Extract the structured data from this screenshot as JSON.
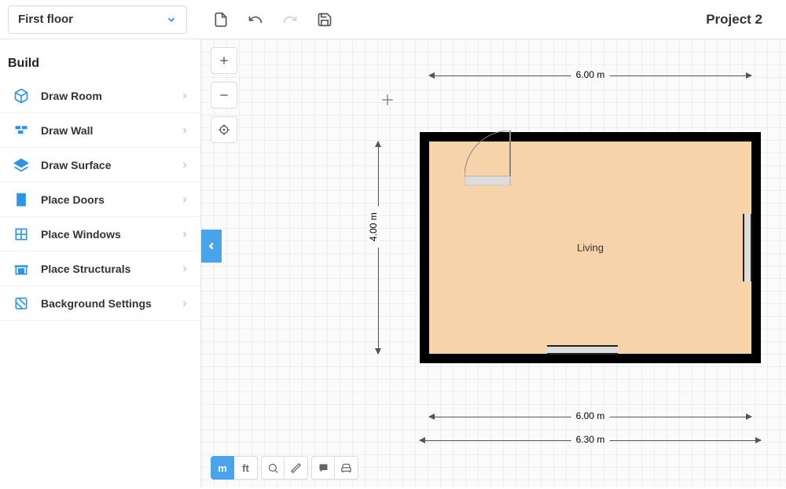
{
  "topbar": {
    "floor": "First floor",
    "title": "Project 2"
  },
  "sidebar": {
    "heading": "Build",
    "items": [
      {
        "label": "Draw Room",
        "icon": "cube"
      },
      {
        "label": "Draw Wall",
        "icon": "wall"
      },
      {
        "label": "Draw Surface",
        "icon": "surface"
      },
      {
        "label": "Place Doors",
        "icon": "door"
      },
      {
        "label": "Place Windows",
        "icon": "window"
      },
      {
        "label": "Place Structurals",
        "icon": "structural"
      },
      {
        "label": "Background Settings",
        "icon": "settings"
      }
    ]
  },
  "floorplan": {
    "room_label": "Living",
    "dimensions": {
      "top_width": "6.00 m",
      "bottom_inner_width": "6.00 m",
      "bottom_outer_width": "6.30 m",
      "left_height": "4.00 m"
    }
  },
  "units": {
    "m": "m",
    "ft": "ft",
    "active": "m"
  }
}
